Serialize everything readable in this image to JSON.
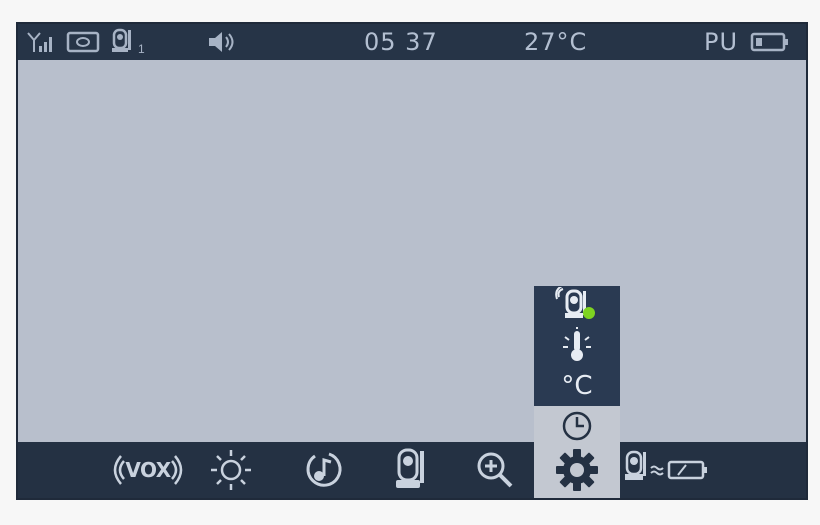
{
  "status_bar": {
    "time": "05 37",
    "temperature": "27°C",
    "pu_label": "PU",
    "icons": [
      "signal-strength-icon",
      "camera-view-icon",
      "camera-1-icon",
      "speaker-volume-icon",
      "battery-icon"
    ],
    "camera_number": "1"
  },
  "menu_bar": {
    "items": [
      {
        "id": "vox",
        "label": "VOX",
        "icon": "vox-icon"
      },
      {
        "id": "brightness",
        "icon": "brightness-icon"
      },
      {
        "id": "lullaby",
        "icon": "music-note-icon"
      },
      {
        "id": "camera",
        "icon": "camera-icon"
      },
      {
        "id": "zoom",
        "icon": "zoom-in-icon"
      },
      {
        "id": "settings",
        "icon": "gear-icon",
        "selected": true
      },
      {
        "id": "pair",
        "icon": "camera-pair-icon"
      }
    ]
  },
  "settings_submenu": {
    "items": [
      {
        "id": "camera-status",
        "icon": "camera-connected-icon"
      },
      {
        "id": "temperature-alert",
        "icon": "thermometer-icon"
      },
      {
        "id": "temperature-unit",
        "label": "°C"
      },
      {
        "id": "clock",
        "icon": "clock-icon",
        "selected": true
      }
    ]
  },
  "colors": {
    "bar_background": "#243143",
    "screen_background": "#b8bfcc",
    "selected_highlight": "#c3c8d1",
    "icon_color": "#c9d2de",
    "connected_indicator": "#7ed321"
  }
}
